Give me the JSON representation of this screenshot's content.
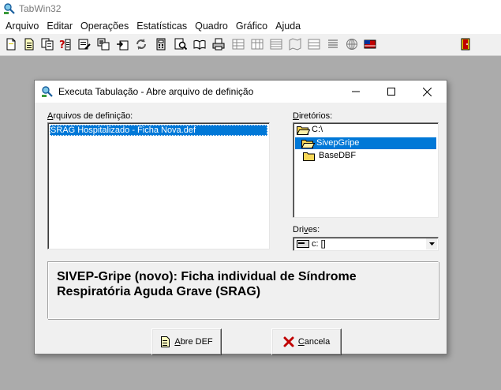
{
  "app": {
    "title": "TabWin32",
    "menu": [
      {
        "label": "Arquivo"
      },
      {
        "label": "Editar"
      },
      {
        "label": "Operações"
      },
      {
        "label": "Estatísticas"
      },
      {
        "label": "Quadro"
      },
      {
        "label": "Gráfico"
      },
      {
        "label": "Ajuda"
      }
    ]
  },
  "dialog": {
    "title": "Executa Tabulação - Abre arquivo de definição",
    "files_label": {
      "ul": "A",
      "rest": "rquivos de definição:"
    },
    "files": [
      "SRAG Hospitalizado - Ficha Nova.def"
    ],
    "dirs_label": {
      "ul": "D",
      "rest": "iretórios:"
    },
    "dirs": [
      "C:\\",
      "SivepGripe",
      "BaseDBF"
    ],
    "drives_label": {
      "pre": "Dri",
      "ul": "v",
      "rest": "es:"
    },
    "drive_value": "c: []",
    "info": " SIVEP-Gripe (novo): Ficha individual de Síndrome\nRespiratória Aguda Grave (SRAG)",
    "ok_button": {
      "ul": "A",
      "rest": "bre DEF"
    },
    "cancel_button": {
      "ul": "C",
      "rest": "ancela"
    }
  },
  "colors": {
    "selection": "#0078d7",
    "desktop": "#ababab",
    "dialog_bg": "#f0f0f0",
    "folder_yellow": "#f8d757"
  }
}
